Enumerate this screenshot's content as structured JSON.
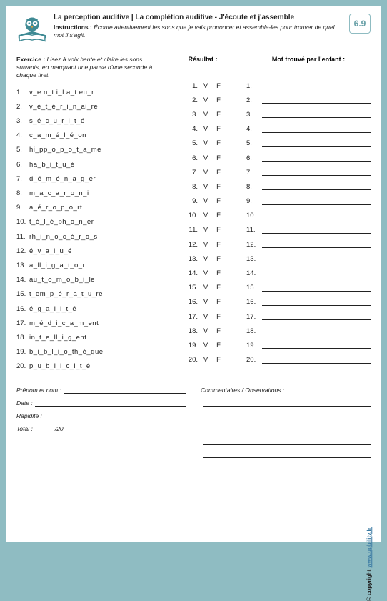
{
  "badge": "6.9",
  "title": "La perception auditive | La complétion auditive - J'écoute et j'assemble",
  "instructions_label": "Instructions :",
  "instructions_text": "Écoute attentivement les sons que je vais prononcer et assemble-les pour trouver de quel mot il s'agit.",
  "exercise_label": "Exercice :",
  "exercise_text": "Lisez à voix haute et claire les sons suivants, en marquant une pause d'une seconde à chaque tiret.",
  "result_header": "Résultat :",
  "found_header": "Mot trouvé par l'enfant :",
  "v_label": "V",
  "f_label": "F",
  "items": [
    {
      "n": "1.",
      "word": "v_e n_t i_l a_t eu_r"
    },
    {
      "n": "2.",
      "word": "v_é_t_é_r_i_n_ai_re"
    },
    {
      "n": "3.",
      "word": "s_é_c_u_r_i_t_é"
    },
    {
      "n": "4.",
      "word": "c_a_m_é_l_é_on"
    },
    {
      "n": "5.",
      "word": "hi_pp_o_p_o_t_a_me"
    },
    {
      "n": "6.",
      "word": "ha_b_i_t_u_é"
    },
    {
      "n": "7.",
      "word": "d_é_m_é_n_a_g_er"
    },
    {
      "n": "8.",
      "word": "m_a_c_a_r_o_n_i"
    },
    {
      "n": "9.",
      "word": "a_é_r_o_p_o_rt"
    },
    {
      "n": "10.",
      "word": "t_é_l_é_ph_o_n_er"
    },
    {
      "n": "11.",
      "word": "rh_i_n_o_c_é_r_o_s"
    },
    {
      "n": "12.",
      "word": "é_v_a_l_u_é"
    },
    {
      "n": "13.",
      "word": "a_ll_i_g_a_t_o_r"
    },
    {
      "n": "14.",
      "word": "au_t_o_m_o_b_i_le"
    },
    {
      "n": "15.",
      "word": "t_em_p_é_r_a_t_u_re"
    },
    {
      "n": "16.",
      "word": "é_g_a_l_i_t_é"
    },
    {
      "n": "17.",
      "word": "m_é_d_i_c_a_m_ent"
    },
    {
      "n": "18.",
      "word": "in_t_e_ll_i_g_ent"
    },
    {
      "n": "19.",
      "word": "b_i_b_l_i_o_th_è_que"
    },
    {
      "n": "20.",
      "word": "p_u_b_l_i_c_i_t_é"
    }
  ],
  "footer": {
    "name": "Prénom et nom :",
    "date": "Date :",
    "speed": "Rapidité :",
    "total": "Total :",
    "total_suffix": "/20",
    "comments": "Commentaires / Observations :"
  },
  "copyright_prefix": "© copyright ",
  "copyright_link": "www.upbility.fr"
}
